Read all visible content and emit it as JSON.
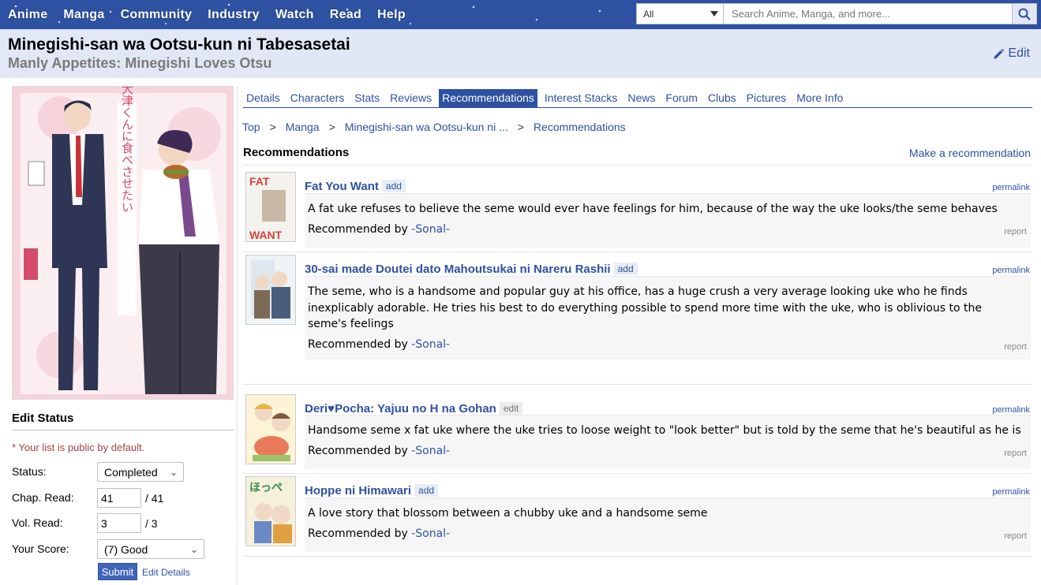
{
  "nav": {
    "items": [
      "Anime",
      "Manga",
      "Community",
      "Industry",
      "Watch",
      "Read",
      "Help"
    ],
    "search_category": "All",
    "search_placeholder": "Search Anime, Manga, and more..."
  },
  "header": {
    "title": "Minegishi-san wa Ootsu-kun ni Tabesasetai",
    "english_title": "Manly Appetites: Minegishi Loves Otsu",
    "edit_label": "Edit"
  },
  "tabs": [
    "Details",
    "Characters",
    "Stats",
    "Reviews",
    "Recommendations",
    "Interest Stacks",
    "News",
    "Forum",
    "Clubs",
    "Pictures",
    "More Info"
  ],
  "active_tab": "Recommendations",
  "breadcrumb": [
    "Top",
    "Manga",
    "Minegishi-san wa Ootsu-kun ni ...",
    "Recommendations"
  ],
  "section": {
    "heading": "Recommendations",
    "make_rec": "Make a recommendation"
  },
  "recs": [
    {
      "title": "Fat You Want",
      "tag": "add",
      "permalink": "permalink",
      "description": "A fat uke refuses to believe the seme would ever have feelings for him, because of the way the uke looks/the seme behaves",
      "recommended_by_label": "Recommended by",
      "user": "-Sonal-",
      "report": "report"
    },
    {
      "title": "30-sai made Doutei dato Mahoutsukai ni Nareru Rashii",
      "tag": "add",
      "permalink": "permalink",
      "description": "The seme, who is a handsome and popular guy at his office, has a huge crush a very average looking uke who he finds inexplicably adorable. He tries his best to do everything possible to spend more time with the uke, who is oblivious to the seme's feelings",
      "recommended_by_label": "Recommended by",
      "user": "-Sonal-",
      "report": "report"
    },
    {
      "title": "Deri♥Pocha: Yajuu no H na Gohan",
      "tag": "edit",
      "permalink": "permalink",
      "description": "Handsome seme x fat uke where the uke tries to loose weight to \"look better\" but is told by the seme that he's beautiful as he is",
      "recommended_by_label": "Recommended by",
      "user": "-Sonal-",
      "report": "report"
    },
    {
      "title": "Hoppe ni Himawari",
      "tag": "add",
      "permalink": "permalink",
      "description": "A love story that blossom between a chubby uke and a handsome seme",
      "recommended_by_label": "Recommended by",
      "user": "-Sonal-",
      "report": "report"
    }
  ],
  "status": {
    "heading": "Edit Status",
    "note": "* Your list is public by default.",
    "status_label": "Status:",
    "status_value": "Completed",
    "chap_label": "Chap. Read:",
    "chap_value": "41",
    "chap_total": "/ 41",
    "vol_label": "Vol. Read:",
    "vol_value": "3",
    "vol_total": "/ 3",
    "score_label": "Your Score:",
    "score_value": "(7) Good",
    "submit": "Submit",
    "edit_details": "Edit Details"
  },
  "colors": {
    "brand": "#2e51a2",
    "header_bg": "#e1e7f5",
    "cover_pink": "#f4c8d3"
  },
  "cover": {
    "vertical_title": "峰岸さんは大津くんに食べさせたい"
  }
}
